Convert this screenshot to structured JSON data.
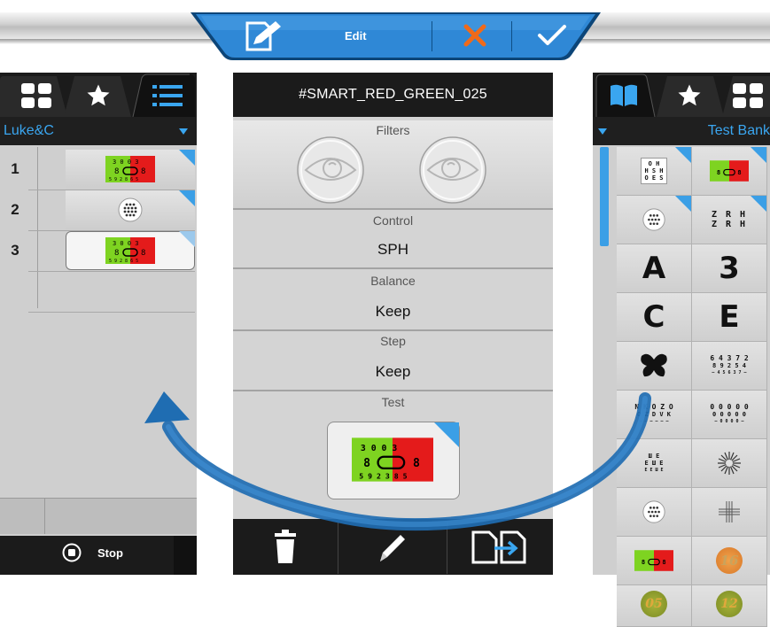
{
  "toolbar": {
    "edit_label": "Edit",
    "accent": "#2a84d2",
    "cancel_color": "#f06a1a",
    "ok_color": "#ffffff"
  },
  "left_panel": {
    "tabs": [
      "grid-view-icon",
      "star-icon",
      "list-view-icon"
    ],
    "list_name": "Luke&C",
    "rows": [
      {
        "num": "1",
        "chart": "red-green-chart"
      },
      {
        "num": "2",
        "chart": "dot-chart"
      },
      {
        "num": "3",
        "chart": "red-green-chart"
      }
    ],
    "stop_label": "Stop"
  },
  "center_panel": {
    "title": "#SMART_RED_GREEN_025",
    "filters_label": "Filters",
    "control_label": "Control",
    "control_value": "SPH",
    "balance_label": "Balance",
    "balance_value": "Keep",
    "step_label": "Step",
    "step_value": "Keep",
    "test_label": "Test",
    "bottom_buttons": [
      "trash-icon",
      "pencil-icon",
      "copy-to-icon"
    ]
  },
  "right_panel": {
    "tabs": [
      "book-icon",
      "star-icon",
      "grid-view-icon"
    ],
    "bank_name": "Test Bank",
    "cells": [
      {
        "kind": "small-letters",
        "text": ""
      },
      {
        "kind": "red-green-chart",
        "text": ""
      },
      {
        "kind": "dot-chart",
        "text": ""
      },
      {
        "kind": "zrh-chart",
        "text": "Z R H"
      },
      {
        "kind": "letter",
        "text": "A"
      },
      {
        "kind": "letter",
        "text": "3"
      },
      {
        "kind": "letter",
        "text": "C"
      },
      {
        "kind": "letter",
        "text": "E"
      },
      {
        "kind": "butterfly-icon",
        "text": ""
      },
      {
        "kind": "number-chart",
        "text": "6 4 3 7 2"
      },
      {
        "kind": "letter-chart",
        "text": "N K O Z O"
      },
      {
        "kind": "circle-chart",
        "text": "0 0 0 0 0"
      },
      {
        "kind": "letter-chart",
        "text": ""
      },
      {
        "kind": "astigmatism-fan",
        "text": ""
      },
      {
        "kind": "dot-chart",
        "text": ""
      },
      {
        "kind": "cross-grid",
        "text": ""
      },
      {
        "kind": "red-green-chart",
        "text": ""
      },
      {
        "kind": "color-plate",
        "text": "16"
      },
      {
        "kind": "color-plate",
        "text": "05"
      },
      {
        "kind": "color-plate",
        "text": "12"
      }
    ]
  }
}
